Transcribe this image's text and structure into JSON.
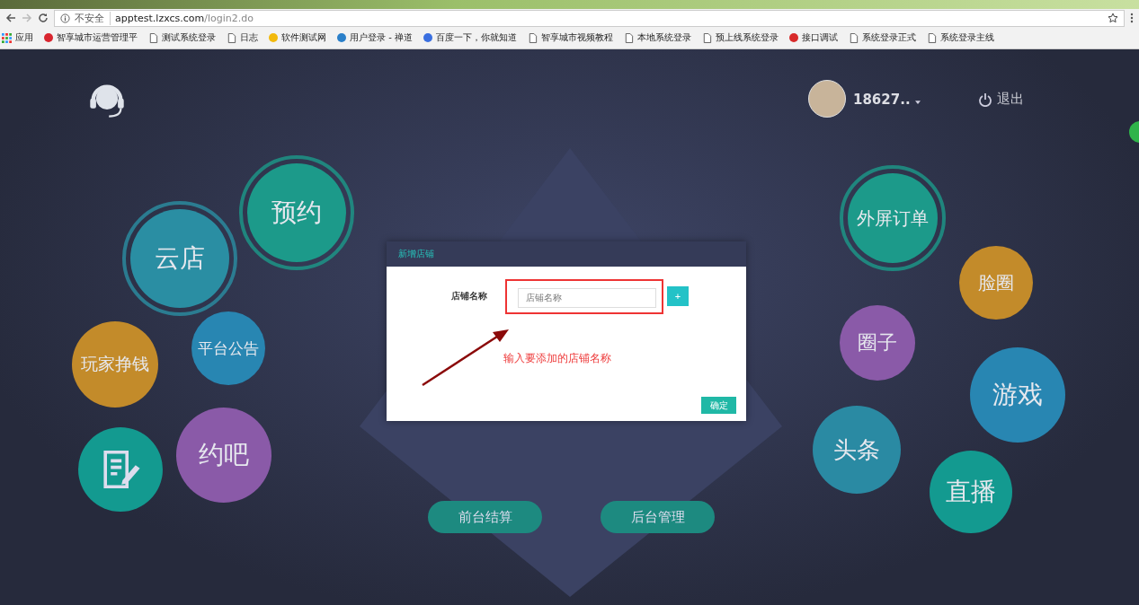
{
  "browser": {
    "security_label": "不安全",
    "url_host": "apptest.lzxcs.com",
    "url_path": "/login2.do",
    "bookmarks": [
      {
        "kind": "apps",
        "label": "应用"
      },
      {
        "kind": "site",
        "label": "智享城市运营管理平",
        "color": "#d9262f"
      },
      {
        "kind": "page",
        "label": "测试系统登录"
      },
      {
        "kind": "page",
        "label": "日志"
      },
      {
        "kind": "site",
        "label": "软件测试网",
        "color": "#f2b90c"
      },
      {
        "kind": "site",
        "label": "用户登录 - 禅道",
        "color": "#2a7fc9"
      },
      {
        "kind": "site",
        "label": "百度一下，你就知道",
        "color": "#3a6fe0"
      },
      {
        "kind": "page",
        "label": "智享城市视频教程"
      },
      {
        "kind": "page",
        "label": "本地系统登录"
      },
      {
        "kind": "page",
        "label": "预上线系统登录"
      },
      {
        "kind": "site",
        "label": "接口调试",
        "color": "#d82a2a"
      },
      {
        "kind": "page",
        "label": "系统登录正式"
      },
      {
        "kind": "page",
        "label": "系统登录主线"
      }
    ]
  },
  "header": {
    "user": "18627..",
    "logout": "退出"
  },
  "bubbles": [
    {
      "kind": "ring",
      "label": "预约",
      "color": "#1c9a8a"
    },
    {
      "kind": "ring",
      "label": "云店",
      "color": "#2a8ea3"
    },
    {
      "kind": "plain",
      "label": "平台公告",
      "color": "#2886b2"
    },
    {
      "kind": "plain",
      "label": "玩家挣钱",
      "color": "#c38b2a"
    },
    {
      "kind": "plain",
      "label": "约吧",
      "color": "#8a5aa8"
    },
    {
      "kind": "icon",
      "color": "#139a90"
    },
    {
      "kind": "ring",
      "label": "外屏订单",
      "color": "#1c9a8a"
    },
    {
      "kind": "plain",
      "label": "脸圈",
      "color": "#c38b2a"
    },
    {
      "kind": "plain",
      "label": "圈子",
      "color": "#8a5aa8"
    },
    {
      "kind": "plain",
      "label": "游戏",
      "color": "#2886b2"
    },
    {
      "kind": "plain",
      "label": "头条",
      "color": "#2a8aa3"
    },
    {
      "kind": "plain",
      "label": "直播",
      "color": "#139a90"
    }
  ],
  "actions": [
    "前台结算",
    "后台管理"
  ],
  "dialog": {
    "title": "新增店铺",
    "field_label": "店铺名称",
    "placeholder": "店铺名称",
    "add": "+",
    "annotation": "输入要添加的店铺名称",
    "confirm": "确定"
  }
}
